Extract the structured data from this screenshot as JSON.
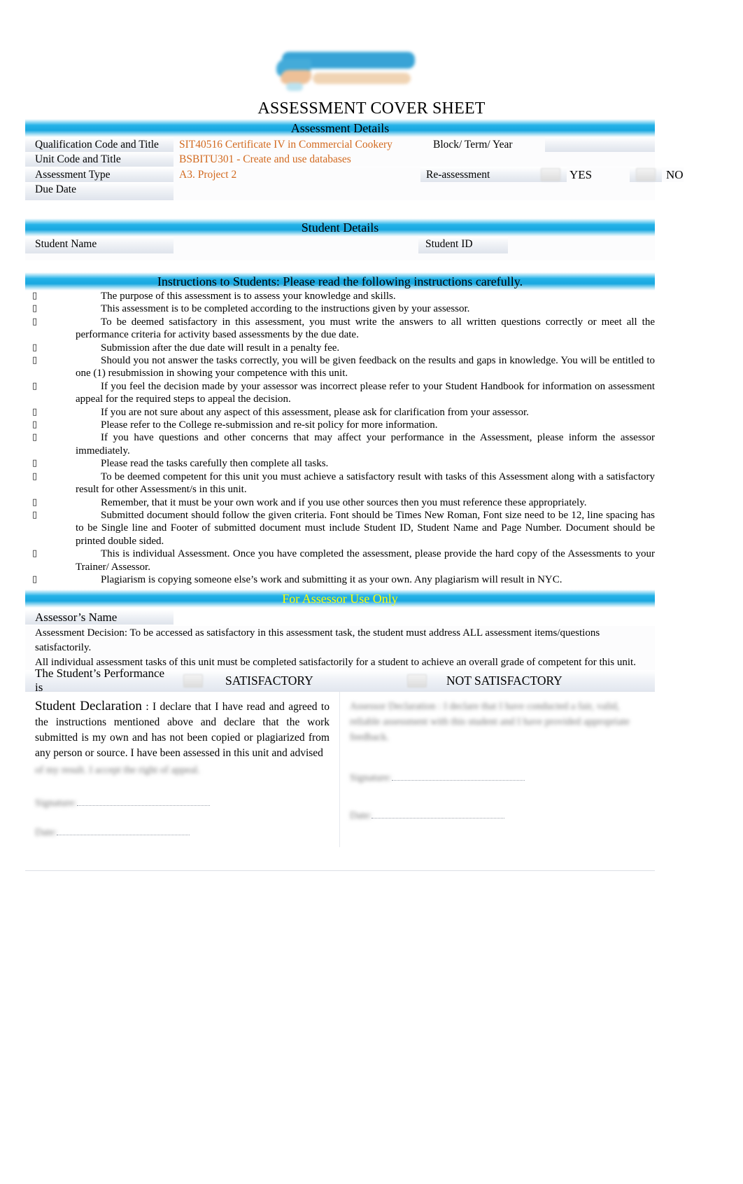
{
  "document": {
    "title": "ASSESSMENT COVER SHEET",
    "logo_alt": "college-logo"
  },
  "assessment_details": {
    "header": "Assessment Details",
    "rows": [
      {
        "label": "Qualification Code and Title",
        "value": "SIT40516 Certificate IV in Commercial Cookery",
        "right_label": "Block/ Term/ Year",
        "right_value": ""
      },
      {
        "label": "Unit Code and Title",
        "value": "BSBITU301 - Create and use databases",
        "right_label": "",
        "right_value": ""
      },
      {
        "label": "Assessment Type",
        "value": "A3. Project 2",
        "right_label": "Re-assessment",
        "yes_label": "YES",
        "no_label": "NO"
      },
      {
        "label": "Due Date",
        "value": "",
        "right_label": "",
        "right_value": ""
      }
    ]
  },
  "student_details": {
    "header": "Student Details",
    "name_label": "Student Name",
    "name_value": "",
    "id_label": "Student ID",
    "id_value": ""
  },
  "instructions": {
    "header": "Instructions to Students:   Please read the following instructions carefully.",
    "bullet_glyph": "▯",
    "items": [
      "The purpose of this assessment is to assess your knowledge and skills.",
      "This assessment is to be completed according to the instructions given by your assessor.",
      "To be deemed satisfactory in this assessment, you must write the answers to all written questions correctly or meet all the performance criteria for activity based assessments by the due date.",
      "Submission after the due date will result in a penalty fee.",
      "Should you not answer the tasks correctly, you will be given feedback on the results and gaps in knowledge. You will be entitled to one (1) resubmission in showing your competence with this unit.",
      "If you feel the decision made by your assessor was incorrect please refer to your Student Handbook for information on assessment appeal for the required steps to appeal the decision.",
      "If you are not sure about any aspect of this assessment, please ask for clarification from your assessor.",
      "Please refer to the College re-submission and re-sit policy for more information.",
      "If you have questions and other concerns that may affect your performance in the Assessment, please inform the assessor immediately.",
      "Please read the tasks carefully then complete all tasks.",
      "To be deemed competent for this unit you must achieve a satisfactory result with tasks of this Assessment along with a satisfactory result for other Assessment/s in this unit.",
      "Remember, that it must be your own work and if you use other sources then you must reference these appropriately.",
      "Submitted document should follow the given criteria. Font should be Times New Roman, Font size need to be 12, line spacing has to be Single line and Footer of submitted document must include Student ID, Student Name and Page Number. Document should be printed double sided.",
      "This is individual Assessment. Once you have completed the assessment, please provide the hard copy of the Assessments to your Trainer/ Assessor.",
      "Plagiarism is copying someone else’s work and submitting it as your own. Any plagiarism will result in NYC."
    ]
  },
  "assessor": {
    "header": "For Assessor Use Only",
    "name_label": "Assessor’s Name",
    "name_value": "",
    "decision_paragraph_1": "Assessment Decision: To be accessed as satisfactory in this assessment task, the student must address ALL assessment items/questions satisfactorily.",
    "decision_paragraph_2": "All individual assessment tasks of this unit must be completed satisfactorily for a student to achieve an overall grade of competent for this unit.",
    "performance_label": "The Student’s Performance is",
    "option_satisfactory": "SATISFACTORY",
    "option_not_satisfactory": "NOT SATISFACTORY"
  },
  "declaration": {
    "title": "Student Declaration",
    "colon": " : ",
    "body": "I declare that I have read and agreed to the instructions mentioned above and declare that the work submitted is my own and has not been copied or plagiarized from any person or source. I have been assessed in this unit and advised",
    "body_redacted_tail": "of my result. I accept the right of appeal.",
    "signature_label": "Signature:",
    "date_label": "Date:",
    "assessor_note_redacted": "Assessor Declaration : I declare that I have conducted a fair, valid, reliable assessment with this student and I have provided appropriate feedback.",
    "assessor_signature_label": "Signature:",
    "assessor_date_label": "Date:"
  },
  "colors": {
    "bar_blue": "#18a7e0",
    "accent_orange": "#d2691e",
    "assessor_header_text": "#ffff00"
  }
}
